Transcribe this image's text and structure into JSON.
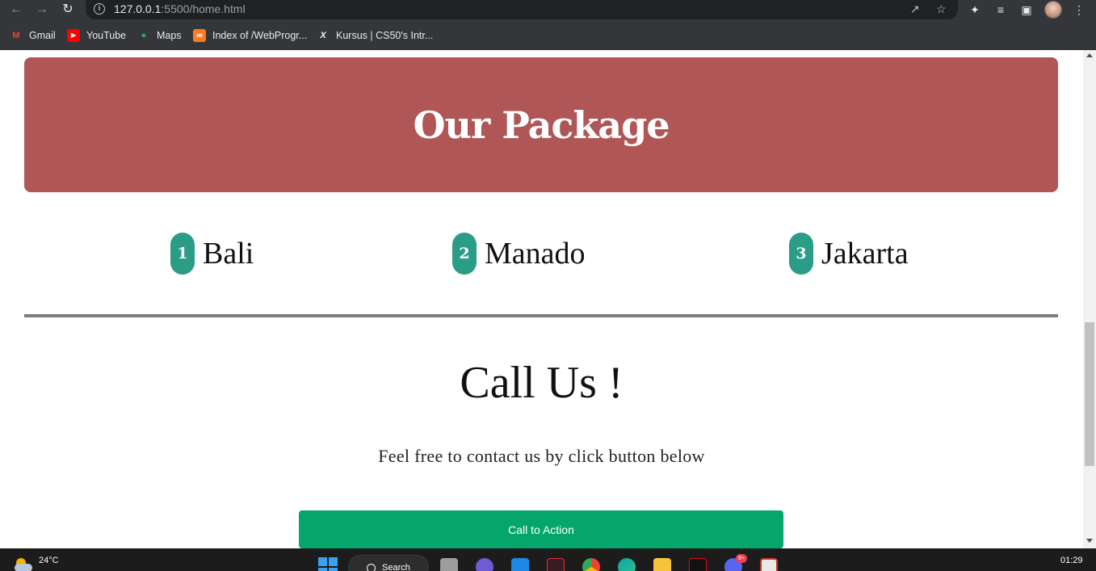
{
  "browser": {
    "url_host": "127.0.0.1",
    "url_path": ":5500/home.html"
  },
  "bookmarks": [
    {
      "label": "Gmail",
      "icon": "gmail-icon",
      "color": "#ea4335"
    },
    {
      "label": "YouTube",
      "icon": "youtube-icon",
      "color": "#ff0000"
    },
    {
      "label": "Maps",
      "icon": "maps-icon",
      "color": "#34a853"
    },
    {
      "label": "Index of /WebProgr...",
      "icon": "xampp-icon",
      "color": "#fb7a24"
    },
    {
      "label": "Kursus | CS50's Intr...",
      "icon": "edx-icon",
      "color": "#ffffff"
    }
  ],
  "hero": {
    "title": "Our Package",
    "background": "#b05656"
  },
  "packages": [
    {
      "number": "1",
      "name": "Bali"
    },
    {
      "number": "2",
      "name": "Manado"
    },
    {
      "number": "3",
      "name": "Jakarta"
    }
  ],
  "package_badge_color": "#2b9c85",
  "call": {
    "title": "Call Us !",
    "subtitle": "Feel free to contact us by click button below",
    "button_label": "Call to Action",
    "button_color": "#05a66b"
  },
  "taskbar": {
    "temperature": "24°C",
    "search_label": "Search",
    "notification_badge": "9+",
    "clock": "01:29"
  }
}
